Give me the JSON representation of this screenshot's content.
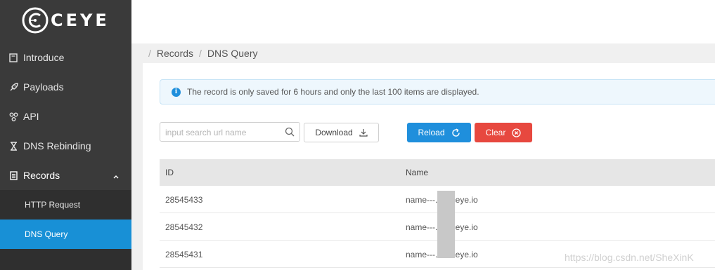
{
  "brand": {
    "name": "CEYE"
  },
  "sidebar": {
    "items": [
      {
        "label": "Introduce",
        "icon": "book-icon"
      },
      {
        "label": "Payloads",
        "icon": "rocket-icon"
      },
      {
        "label": "API",
        "icon": "share-icon"
      },
      {
        "label": "DNS Rebinding",
        "icon": "hourglass-icon"
      },
      {
        "label": "Records",
        "icon": "list-icon",
        "expanded": true
      }
    ],
    "subitems": [
      {
        "label": "HTTP Request"
      },
      {
        "label": "DNS Query",
        "selected": true
      }
    ]
  },
  "breadcrumb": {
    "parent": "Records",
    "current": "DNS Query"
  },
  "alert": {
    "text": "The record is only saved for 6 hours and only the last 100 items are displayed."
  },
  "toolbar": {
    "search_placeholder": "input search url name",
    "download_label": "Download",
    "reload_label": "Reload",
    "clear_label": "Clear"
  },
  "table": {
    "columns": [
      "ID",
      "Name"
    ],
    "rows": [
      {
        "id": "28545433",
        "name": "name---.       s1.ceye.io"
      },
      {
        "id": "28545432",
        "name": "name---.       s1.ceye.io"
      },
      {
        "id": "28545431",
        "name": "name---.       s1.ceye.io"
      }
    ]
  },
  "watermark": "https://blog.csdn.net/SheXinK",
  "colors": {
    "sidebar_bg": "#3a3a3a",
    "selected_blue": "#1890d6",
    "reload_blue": "#1f8fdc",
    "clear_red": "#e7483f"
  }
}
